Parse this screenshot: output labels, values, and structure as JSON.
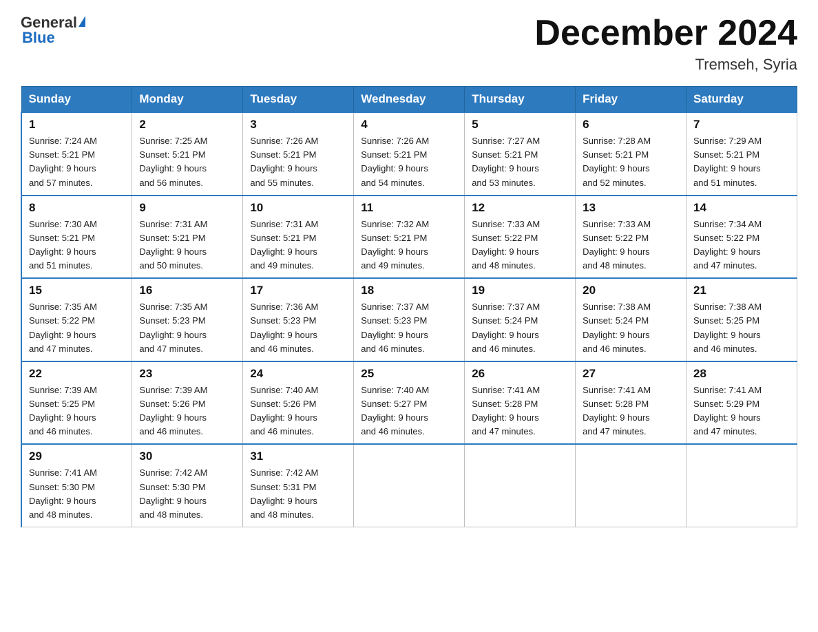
{
  "logo": {
    "general": "General",
    "blue": "Blue",
    "triangle_color": "#1a6bbf"
  },
  "title": "December 2024",
  "subtitle": "Tremseh, Syria",
  "days_header": [
    "Sunday",
    "Monday",
    "Tuesday",
    "Wednesday",
    "Thursday",
    "Friday",
    "Saturday"
  ],
  "weeks": [
    [
      {
        "day": "1",
        "sunrise": "7:24 AM",
        "sunset": "5:21 PM",
        "daylight": "9 hours and 57 minutes."
      },
      {
        "day": "2",
        "sunrise": "7:25 AM",
        "sunset": "5:21 PM",
        "daylight": "9 hours and 56 minutes."
      },
      {
        "day": "3",
        "sunrise": "7:26 AM",
        "sunset": "5:21 PM",
        "daylight": "9 hours and 55 minutes."
      },
      {
        "day": "4",
        "sunrise": "7:26 AM",
        "sunset": "5:21 PM",
        "daylight": "9 hours and 54 minutes."
      },
      {
        "day": "5",
        "sunrise": "7:27 AM",
        "sunset": "5:21 PM",
        "daylight": "9 hours and 53 minutes."
      },
      {
        "day": "6",
        "sunrise": "7:28 AM",
        "sunset": "5:21 PM",
        "daylight": "9 hours and 52 minutes."
      },
      {
        "day": "7",
        "sunrise": "7:29 AM",
        "sunset": "5:21 PM",
        "daylight": "9 hours and 51 minutes."
      }
    ],
    [
      {
        "day": "8",
        "sunrise": "7:30 AM",
        "sunset": "5:21 PM",
        "daylight": "9 hours and 51 minutes."
      },
      {
        "day": "9",
        "sunrise": "7:31 AM",
        "sunset": "5:21 PM",
        "daylight": "9 hours and 50 minutes."
      },
      {
        "day": "10",
        "sunrise": "7:31 AM",
        "sunset": "5:21 PM",
        "daylight": "9 hours and 49 minutes."
      },
      {
        "day": "11",
        "sunrise": "7:32 AM",
        "sunset": "5:21 PM",
        "daylight": "9 hours and 49 minutes."
      },
      {
        "day": "12",
        "sunrise": "7:33 AM",
        "sunset": "5:22 PM",
        "daylight": "9 hours and 48 minutes."
      },
      {
        "day": "13",
        "sunrise": "7:33 AM",
        "sunset": "5:22 PM",
        "daylight": "9 hours and 48 minutes."
      },
      {
        "day": "14",
        "sunrise": "7:34 AM",
        "sunset": "5:22 PM",
        "daylight": "9 hours and 47 minutes."
      }
    ],
    [
      {
        "day": "15",
        "sunrise": "7:35 AM",
        "sunset": "5:22 PM",
        "daylight": "9 hours and 47 minutes."
      },
      {
        "day": "16",
        "sunrise": "7:35 AM",
        "sunset": "5:23 PM",
        "daylight": "9 hours and 47 minutes."
      },
      {
        "day": "17",
        "sunrise": "7:36 AM",
        "sunset": "5:23 PM",
        "daylight": "9 hours and 46 minutes."
      },
      {
        "day": "18",
        "sunrise": "7:37 AM",
        "sunset": "5:23 PM",
        "daylight": "9 hours and 46 minutes."
      },
      {
        "day": "19",
        "sunrise": "7:37 AM",
        "sunset": "5:24 PM",
        "daylight": "9 hours and 46 minutes."
      },
      {
        "day": "20",
        "sunrise": "7:38 AM",
        "sunset": "5:24 PM",
        "daylight": "9 hours and 46 minutes."
      },
      {
        "day": "21",
        "sunrise": "7:38 AM",
        "sunset": "5:25 PM",
        "daylight": "9 hours and 46 minutes."
      }
    ],
    [
      {
        "day": "22",
        "sunrise": "7:39 AM",
        "sunset": "5:25 PM",
        "daylight": "9 hours and 46 minutes."
      },
      {
        "day": "23",
        "sunrise": "7:39 AM",
        "sunset": "5:26 PM",
        "daylight": "9 hours and 46 minutes."
      },
      {
        "day": "24",
        "sunrise": "7:40 AM",
        "sunset": "5:26 PM",
        "daylight": "9 hours and 46 minutes."
      },
      {
        "day": "25",
        "sunrise": "7:40 AM",
        "sunset": "5:27 PM",
        "daylight": "9 hours and 46 minutes."
      },
      {
        "day": "26",
        "sunrise": "7:41 AM",
        "sunset": "5:28 PM",
        "daylight": "9 hours and 47 minutes."
      },
      {
        "day": "27",
        "sunrise": "7:41 AM",
        "sunset": "5:28 PM",
        "daylight": "9 hours and 47 minutes."
      },
      {
        "day": "28",
        "sunrise": "7:41 AM",
        "sunset": "5:29 PM",
        "daylight": "9 hours and 47 minutes."
      }
    ],
    [
      {
        "day": "29",
        "sunrise": "7:41 AM",
        "sunset": "5:30 PM",
        "daylight": "9 hours and 48 minutes."
      },
      {
        "day": "30",
        "sunrise": "7:42 AM",
        "sunset": "5:30 PM",
        "daylight": "9 hours and 48 minutes."
      },
      {
        "day": "31",
        "sunrise": "7:42 AM",
        "sunset": "5:31 PM",
        "daylight": "9 hours and 48 minutes."
      },
      null,
      null,
      null,
      null
    ]
  ],
  "labels": {
    "sunrise": "Sunrise:",
    "sunset": "Sunset:",
    "daylight": "Daylight:"
  }
}
